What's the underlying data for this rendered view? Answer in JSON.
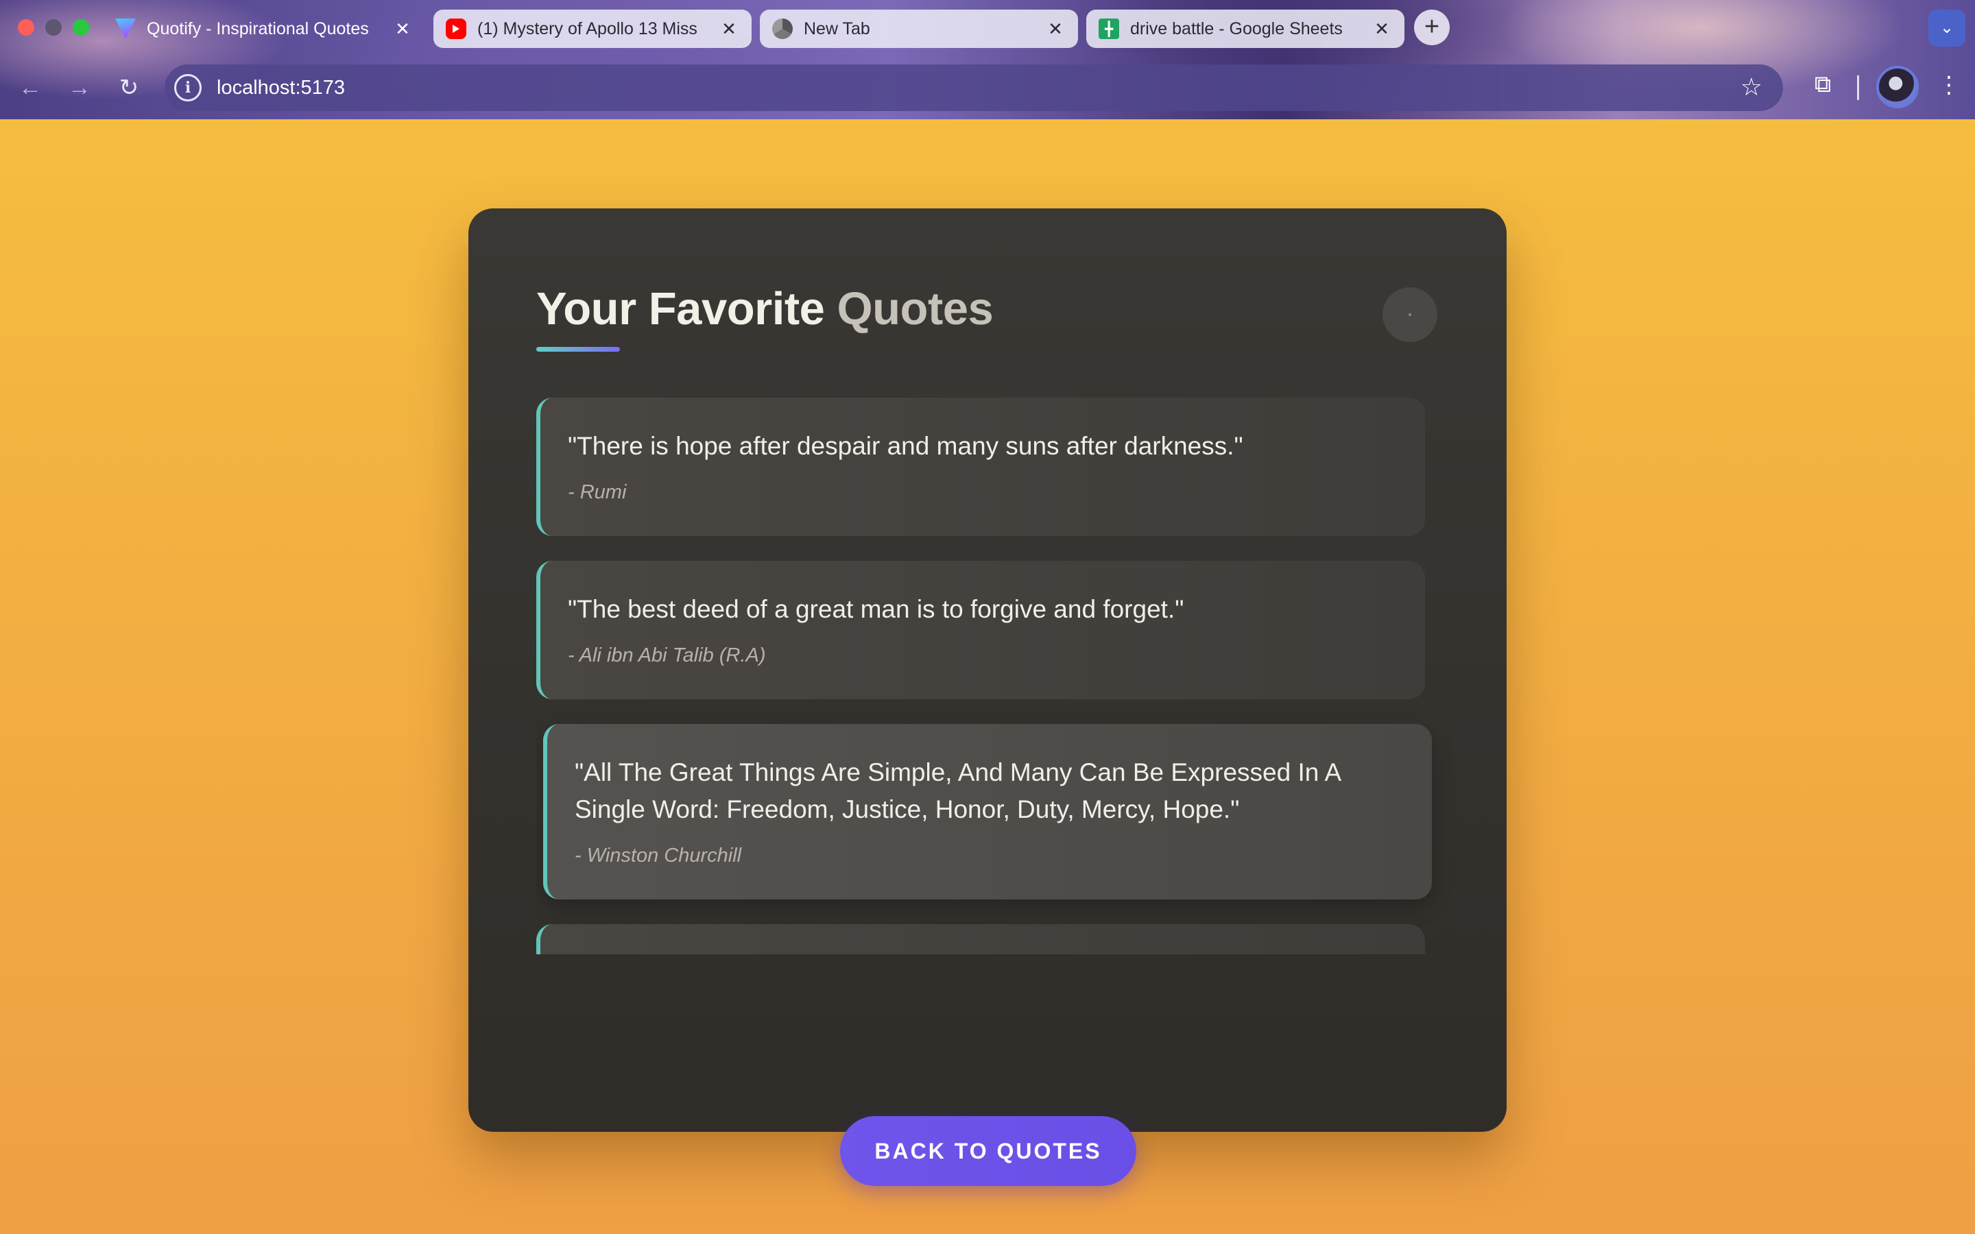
{
  "browser": {
    "tabs": [
      {
        "title": "Quotify - Inspirational Quotes",
        "icon": "vite-icon",
        "active": true
      },
      {
        "title": "(1) Mystery of Apollo 13 Miss",
        "icon": "youtube-icon",
        "active": false
      },
      {
        "title": "New Tab",
        "icon": "chrome-icon",
        "active": false
      },
      {
        "title": "drive battle - Google Sheets",
        "icon": "sheets-icon",
        "active": false
      }
    ],
    "tab_close_glyph": "✕",
    "new_tab_glyph": "+",
    "tab_search_glyph": "⌄",
    "url": "localhost:5173"
  },
  "page": {
    "title_main": "Your Favorite ",
    "title_accent": "Quotes",
    "quotes": [
      {
        "text": "\"There is hope after despair and many suns after darkness.\"",
        "author": "- Rumi"
      },
      {
        "text": "\"The best deed of a great man is to forgive and forget.\"",
        "author": "- Ali ibn Abi Talib (R.A)"
      },
      {
        "text": "\"All The Great Things Are Simple, And Many Can Be Expressed In A Single Word: Freedom, Justice, Honor, Duty, Mercy, Hope.\"",
        "author": "- Winston Churchill"
      }
    ],
    "back_button_label": "BACK TO QUOTES"
  },
  "colors": {
    "background": "#f2ad42",
    "card": "#35332f",
    "accent_teal": "#5fc6b8",
    "button": "#6c52e8"
  }
}
